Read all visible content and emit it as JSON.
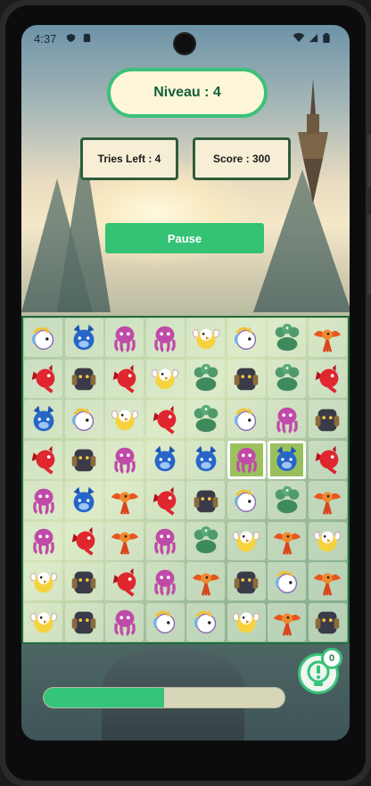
{
  "status_bar": {
    "time": "4:37",
    "left_icons": [
      "shield-icon",
      "sd-card-icon"
    ],
    "right_icons": [
      "wifi-icon",
      "signal-icon",
      "battery-icon"
    ]
  },
  "header": {
    "level_label": "Niveau : 4"
  },
  "stats": {
    "tries_label": "Tries Left : 4",
    "score_label": "Score : 300"
  },
  "controls": {
    "pause_label": "Pause"
  },
  "board": {
    "rows": [
      [
        "unicorn",
        "wolf",
        "octopus",
        "octopus",
        "griffin",
        "unicorn",
        "hydra",
        "phoenix"
      ],
      [
        "dragon",
        "golem",
        "dragon",
        "griffin",
        "hydra",
        "golem",
        "hydra",
        "dragon"
      ],
      [
        "wolf",
        "unicorn",
        "griffin",
        "dragon",
        "hydra",
        "unicorn",
        "octopus",
        "golem"
      ],
      [
        "dragon",
        "golem",
        "octopus",
        "wolf",
        "wolf",
        "octopus",
        "wolf",
        "dragon"
      ],
      [
        "octopus",
        "wolf",
        "phoenix",
        "dragon",
        "golem",
        "unicorn",
        "hydra",
        "phoenix"
      ],
      [
        "octopus",
        "dragon",
        "phoenix",
        "octopus",
        "hydra",
        "griffin",
        "phoenix",
        "griffin"
      ],
      [
        "griffin",
        "golem",
        "dragon",
        "octopus",
        "phoenix",
        "golem",
        "unicorn",
        "phoenix"
      ],
      [
        "griffin",
        "golem",
        "octopus",
        "unicorn",
        "unicorn",
        "griffin",
        "phoenix",
        "golem"
      ]
    ],
    "selected": [
      [
        3,
        5
      ],
      [
        3,
        6
      ]
    ]
  },
  "progress": {
    "value": 0.5
  },
  "hint": {
    "count": "0",
    "icon": "lightbulb-icon"
  },
  "colors": {
    "accent": "#34c274",
    "board_border": "#1f6b3a",
    "pill_bg": "#fdf6d8"
  }
}
